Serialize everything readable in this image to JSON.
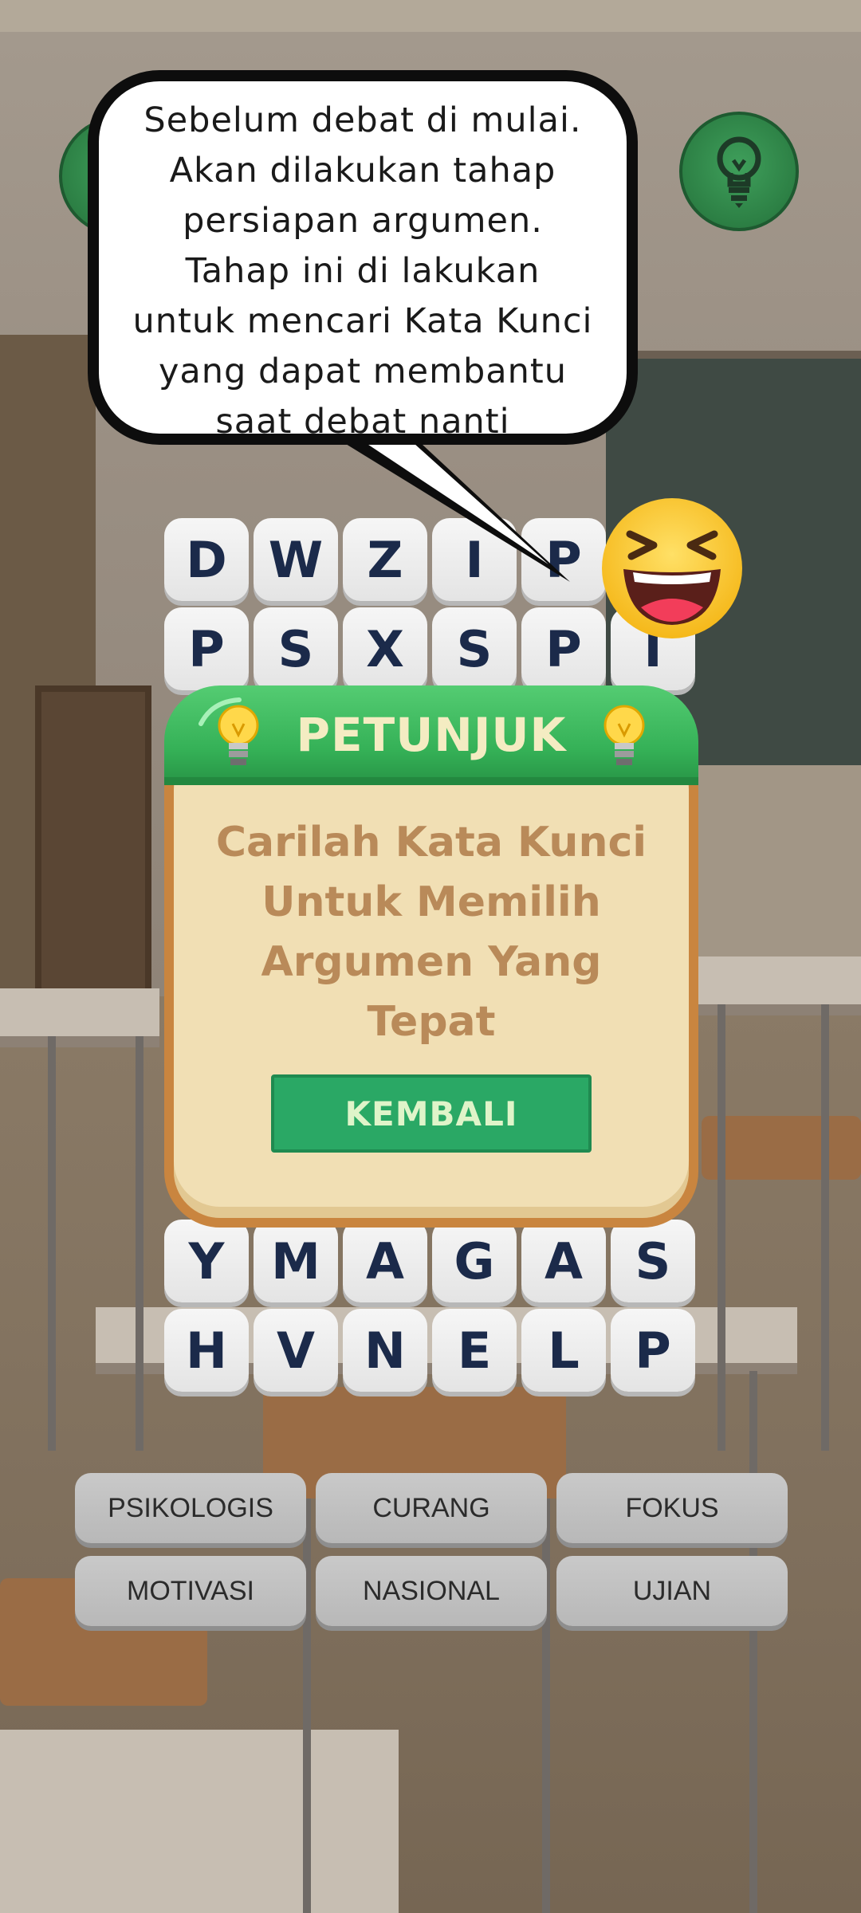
{
  "speech_bubble": {
    "lines": [
      "Sebelum debat di mulai.",
      "Akan dilakukan tahap",
      "persiapan argumen.",
      "Tahap ini di lakukan",
      "untuk mencari Kata Kunci",
      "yang dapat membantu",
      "saat debat nanti"
    ]
  },
  "grid": {
    "rows": [
      [
        "D",
        "W",
        "Z",
        "I",
        "P"
      ],
      [
        "P",
        "S",
        "X",
        "S",
        "P",
        "I"
      ],
      [
        "Y",
        "M",
        "A",
        "G",
        "A",
        "S"
      ],
      [
        "H",
        "V",
        "N",
        "E",
        "L",
        "P"
      ]
    ]
  },
  "hint_dialog": {
    "title": "PETUNJUK",
    "message_lines": [
      "Carilah Kata Kunci",
      "Untuk Memilih",
      "Argumen Yang",
      "Tepat"
    ],
    "back_label": "KEMBALI"
  },
  "words": [
    "PSIKOLOGIS",
    "CURANG",
    "FOKUS",
    "MOTIVASI",
    "NASIONAL",
    "UJIAN"
  ],
  "icons": {
    "hint_button": "lightbulb-icon",
    "emoji": "laughing-emoji-icon"
  },
  "colors": {
    "green_button": "#2c7f44",
    "dialog_header": "#35b157",
    "dialog_body": "#f1dfb4",
    "dialog_border": "#c9853f",
    "back_button": "#2aa865",
    "tile_letter": "#1b2a4a"
  }
}
